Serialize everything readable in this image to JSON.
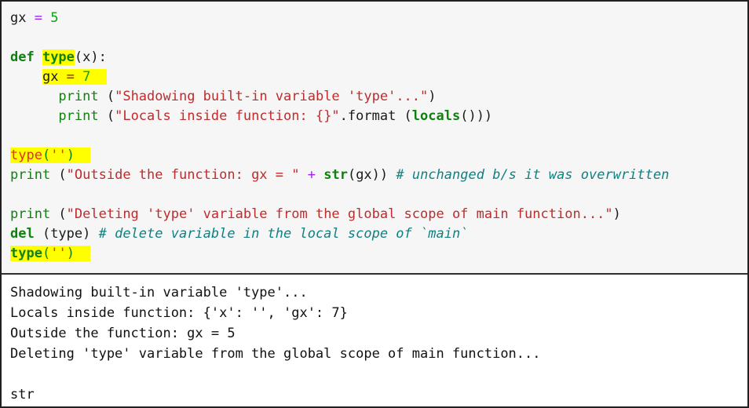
{
  "app": {
    "kind": "code-editor-with-output",
    "language": "python"
  },
  "colors": {
    "code_background": "#f6f6f6",
    "output_background": "#ffffff",
    "border": "#202020",
    "highlight": "#ffff00",
    "keyword": "#108010",
    "string": "#c02b2b",
    "number": "#11a011",
    "operator": "#a020f0",
    "comment": "#108080",
    "shadowed_builtin": "#e03020",
    "text": "#1a1a1a"
  },
  "code": {
    "lines": [
      {
        "id": "line-1",
        "plain": "gx = 5",
        "tokens": [
          {
            "t": "gx ",
            "c": "punc"
          },
          {
            "t": "=",
            "c": "op"
          },
          {
            "t": " ",
            "c": "punc"
          },
          {
            "t": "5",
            "c": "num"
          }
        ]
      },
      {
        "id": "line-2",
        "plain": "",
        "tokens": []
      },
      {
        "id": "line-3",
        "plain": "def type(x):",
        "tokens": [
          {
            "t": "def ",
            "c": "kw"
          },
          {
            "t": "type",
            "c": "builtin",
            "hl": true
          },
          {
            "t": "(x):",
            "c": "punc"
          }
        ]
      },
      {
        "id": "line-4",
        "plain": "    gx = 7",
        "tokens": [
          {
            "t": "    ",
            "c": "punc"
          },
          {
            "t": "gx ",
            "c": "punc",
            "hl": true
          },
          {
            "t": "=",
            "c": "opred",
            "hl": true
          },
          {
            "t": " ",
            "c": "punc",
            "hl": true
          },
          {
            "t": "7",
            "c": "num",
            "hl": true
          },
          {
            "t": "  ",
            "c": "punc",
            "hl": true
          }
        ]
      },
      {
        "id": "line-5",
        "plain": "      print (\"Shadowing built-in variable 'type'...\")",
        "tokens": [
          {
            "t": "      ",
            "c": "punc"
          },
          {
            "t": "print",
            "c": "fn"
          },
          {
            "t": " (",
            "c": "punc"
          },
          {
            "t": "\"Shadowing built-in variable 'type'...\"",
            "c": "str"
          },
          {
            "t": ")",
            "c": "punc"
          }
        ]
      },
      {
        "id": "line-6",
        "plain": "      print (\"Locals inside function: {}\".format (locals()))",
        "tokens": [
          {
            "t": "      ",
            "c": "punc"
          },
          {
            "t": "print",
            "c": "fn"
          },
          {
            "t": " (",
            "c": "punc"
          },
          {
            "t": "\"Locals inside function: {}\"",
            "c": "str"
          },
          {
            "t": ".format (",
            "c": "punc"
          },
          {
            "t": "locals",
            "c": "builtin"
          },
          {
            "t": "()))",
            "c": "punc"
          }
        ]
      },
      {
        "id": "line-7",
        "plain": "",
        "tokens": []
      },
      {
        "id": "line-8",
        "plain": "type('')",
        "tokens": [
          {
            "t": "type",
            "c": "redfn",
            "hl": true
          },
          {
            "t": "(",
            "c": "fn",
            "hl": true
          },
          {
            "t": "''",
            "c": "redfn",
            "hl": true
          },
          {
            "t": ")",
            "c": "fn",
            "hl": true
          },
          {
            "t": "  ",
            "c": "punc",
            "hl": true
          }
        ]
      },
      {
        "id": "line-9",
        "plain": "print (\"Outside the function: gx = \" + str(gx)) # unchanged b/s it was overwritten",
        "tokens": [
          {
            "t": "print",
            "c": "fn"
          },
          {
            "t": " (",
            "c": "punc"
          },
          {
            "t": "\"Outside the function: gx = \"",
            "c": "str"
          },
          {
            "t": " ",
            "c": "punc"
          },
          {
            "t": "+",
            "c": "op"
          },
          {
            "t": " ",
            "c": "punc"
          },
          {
            "t": "str",
            "c": "builtin"
          },
          {
            "t": "(gx)) ",
            "c": "punc"
          },
          {
            "t": "# unchanged b/s it was overwritten",
            "c": "cmt"
          }
        ]
      },
      {
        "id": "line-10",
        "plain": "",
        "tokens": []
      },
      {
        "id": "line-11",
        "plain": "print (\"Deleting 'type' variable from the global scope of main function...\")",
        "tokens": [
          {
            "t": "print",
            "c": "fn"
          },
          {
            "t": " (",
            "c": "punc"
          },
          {
            "t": "\"Deleting 'type' variable from the global scope of main function...\"",
            "c": "str"
          },
          {
            "t": ")",
            "c": "punc"
          }
        ]
      },
      {
        "id": "line-12",
        "plain": "del (type) # delete variable in the local scope of `main`",
        "tokens": [
          {
            "t": "del",
            "c": "kw"
          },
          {
            "t": " (type) ",
            "c": "punc"
          },
          {
            "t": "# delete variable in the local scope of `main`",
            "c": "cmt"
          }
        ]
      },
      {
        "id": "line-13",
        "plain": "type('')",
        "tokens": [
          {
            "t": "type",
            "c": "builtin",
            "hl": true
          },
          {
            "t": "(",
            "c": "fn",
            "hl": true
          },
          {
            "t": "''",
            "c": "redfn",
            "hl": true
          },
          {
            "t": ")",
            "c": "fn",
            "hl": true
          },
          {
            "t": "  ",
            "c": "punc",
            "hl": true
          }
        ]
      }
    ]
  },
  "output": {
    "lines": [
      "Shadowing built-in variable 'type'...",
      "Locals inside function: {'x': '', 'gx': 7}",
      "Outside the function: gx = 5",
      "Deleting 'type' variable from the global scope of main function...",
      "",
      "str"
    ]
  }
}
